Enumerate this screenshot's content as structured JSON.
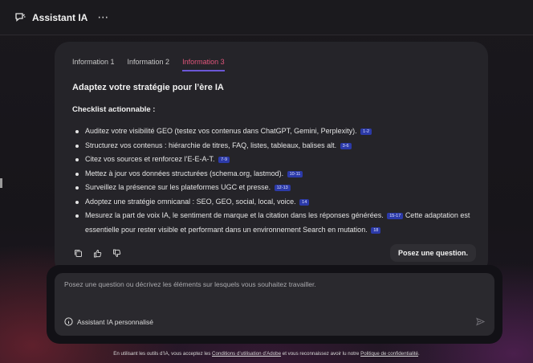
{
  "header": {
    "title": "Assistant IA",
    "more_label": "⋯"
  },
  "tabs": [
    {
      "label": "Information 1",
      "active": false
    },
    {
      "label": "Information 2",
      "active": false
    },
    {
      "label": "Information 3",
      "active": true
    }
  ],
  "content": {
    "heading": "Adaptez votre stratégie pour l’ère IA",
    "subheading": "Checklist actionnable :",
    "items": [
      {
        "text": "Auditez votre visibilité GEO (testez vos contenus dans ChatGPT, Gemini, Perplexity).",
        "cite": "1-2"
      },
      {
        "text": "Structurez vos contenus : hiérarchie de titres, FAQ, listes, tableaux, balises alt.",
        "cite": "3-6"
      },
      {
        "text": "Citez vos sources et renforcez l’E-E-A-T.",
        "cite": "7-9"
      },
      {
        "text": "Mettez à jour vos données structurées (schema.org, lastmod).",
        "cite": "10-11"
      },
      {
        "text": "Surveillez la présence sur les plateformes UGC et presse.",
        "cite": "12-13"
      },
      {
        "text": "Adoptez une stratégie omnicanal : SEO, GEO, social, local, voice.",
        "cite": "14"
      },
      {
        "text": "Mesurez la part de voix IA, le sentiment de marque et la citation dans les réponses générées.",
        "cite": "15-17",
        "tail": "Cette adaptation est essentielle pour rester visible et performant dans un environnement Search en mutation.",
        "tail_cite": "18"
      }
    ]
  },
  "tooltip": "Posez une question.",
  "input": {
    "placeholder": "Posez une question ou décrivez les éléments sur lesquels vous souhaitez travailler.",
    "assistant_label": "Assistant IA personnalisé"
  },
  "footer": {
    "prefix": "En utilisant les outils d’IA, vous acceptez les ",
    "terms_link": "Conditions d’utilisation d’Adobe",
    "middle": " et vous reconnaissez avoir lu notre ",
    "privacy_link": "Politique de confidentialité",
    "suffix": "."
  },
  "colors": {
    "accent_tab": "#e0557b",
    "tab_underline": "#6b57d6",
    "cite_badge": "#2c3aa8"
  }
}
